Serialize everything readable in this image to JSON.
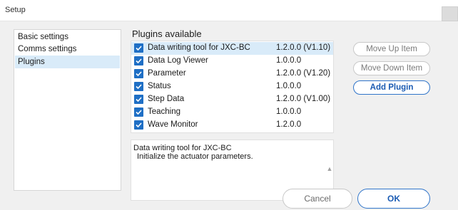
{
  "window": {
    "title": "Setup"
  },
  "sidebar": {
    "items": [
      {
        "label": "Basic settings",
        "selected": false
      },
      {
        "label": "Comms settings",
        "selected": false
      },
      {
        "label": "Plugins",
        "selected": true
      }
    ]
  },
  "plugins": {
    "section_title": "Plugins available",
    "items": [
      {
        "name": "Data writing tool for JXC-BC",
        "version": "1.2.0.0 (V1.10)",
        "checked": true,
        "selected": true
      },
      {
        "name": "Data Log Viewer",
        "version": "1.0.0.0",
        "checked": true,
        "selected": false
      },
      {
        "name": "Parameter",
        "version": "1.2.0.0 (V1.20)",
        "checked": true,
        "selected": false
      },
      {
        "name": "Status",
        "version": "1.0.0.0",
        "checked": true,
        "selected": false
      },
      {
        "name": "Step Data",
        "version": "1.2.0.0 (V1.00)",
        "checked": true,
        "selected": false
      },
      {
        "name": "Teaching",
        "version": "1.0.0.0",
        "checked": true,
        "selected": false
      },
      {
        "name": "Wave Monitor",
        "version": "1.2.0.0",
        "checked": true,
        "selected": false
      }
    ],
    "description": {
      "line1": "Data writing tool for JXC-BC",
      "line2": "Initialize the actuator parameters."
    }
  },
  "actions": {
    "move_up": "Move Up Item",
    "move_down": "Move Down Item",
    "add_plugin": "Add Plugin"
  },
  "dialog": {
    "cancel": "Cancel",
    "ok": "OK"
  },
  "colors": {
    "accent": "#2f74c9",
    "selection": "#d9ebf9",
    "checkbox": "#1f6fc5",
    "panel_bg": "#f0f0f0"
  }
}
